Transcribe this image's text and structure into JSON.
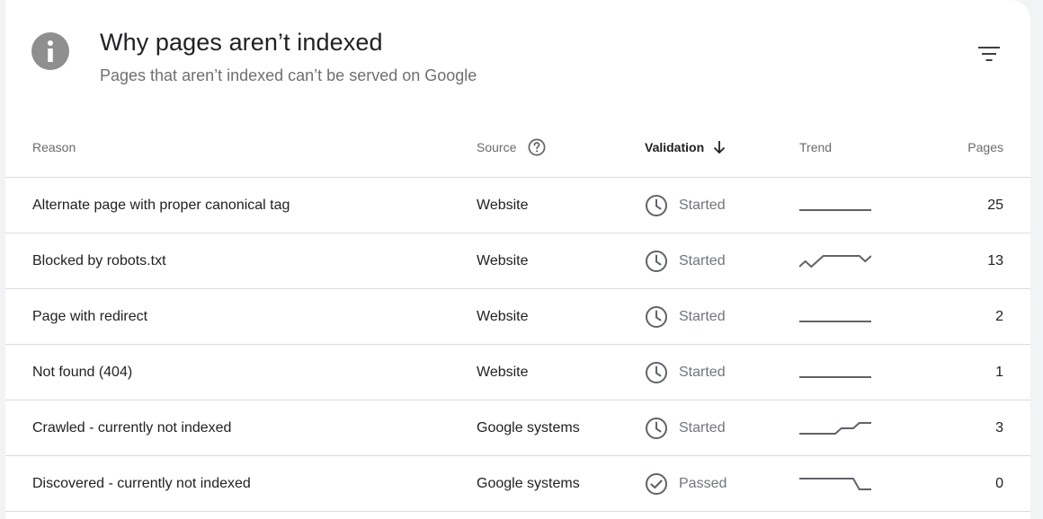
{
  "header": {
    "title": "Why pages aren’t indexed",
    "subtitle": "Pages that aren’t indexed can’t be served on Google",
    "info_icon": "info-icon",
    "filter_icon": "filter-icon"
  },
  "table": {
    "columns": {
      "reason": "Reason",
      "source": "Source",
      "validation": "Validation",
      "trend": "Trend",
      "pages": "Pages"
    },
    "sort": {
      "column": "validation",
      "direction": "descending"
    },
    "rows": [
      {
        "reason": "Alternate page with proper canonical tag",
        "source": "Website",
        "validation": "Started",
        "status_icon": "clock-icon",
        "trend": [
          25,
          25,
          25,
          25,
          25,
          25,
          25,
          25,
          25,
          25,
          25,
          25,
          25
        ],
        "pages": "25"
      },
      {
        "reason": "Blocked by robots.txt",
        "source": "Website",
        "validation": "Started",
        "status_icon": "clock-icon",
        "trend": [
          11,
          12,
          11,
          12,
          13,
          13,
          13,
          13,
          13,
          13,
          13,
          12,
          13
        ],
        "pages": "13"
      },
      {
        "reason": "Page with redirect",
        "source": "Website",
        "validation": "Started",
        "status_icon": "clock-icon",
        "trend": [
          2,
          2,
          2,
          2,
          2,
          2,
          2,
          2,
          2,
          2,
          2,
          2,
          2
        ],
        "pages": "2"
      },
      {
        "reason": "Not found (404)",
        "source": "Website",
        "validation": "Started",
        "status_icon": "clock-icon",
        "trend": [
          1,
          1,
          1,
          1,
          1,
          1,
          1,
          1,
          1,
          1,
          1,
          1,
          1
        ],
        "pages": "1"
      },
      {
        "reason": "Crawled - currently not indexed",
        "source": "Google systems",
        "validation": "Started",
        "status_icon": "clock-icon",
        "trend": [
          1,
          1,
          1,
          1,
          1,
          1,
          1,
          2,
          2,
          2,
          3,
          3,
          3
        ],
        "pages": "3"
      },
      {
        "reason": "Discovered - currently not indexed",
        "source": "Google systems",
        "validation": "Passed",
        "status_icon": "check-circle-icon",
        "trend": [
          4,
          4,
          4,
          4,
          4,
          4,
          4,
          4,
          4,
          4,
          0,
          0,
          0
        ],
        "pages": "0"
      }
    ]
  },
  "colors": {
    "text_primary": "#202124",
    "text_secondary": "#6f6f6f",
    "icon_gray": "#5f6368",
    "divider": "#dadce0",
    "info_bg": "#8f8f8f"
  }
}
